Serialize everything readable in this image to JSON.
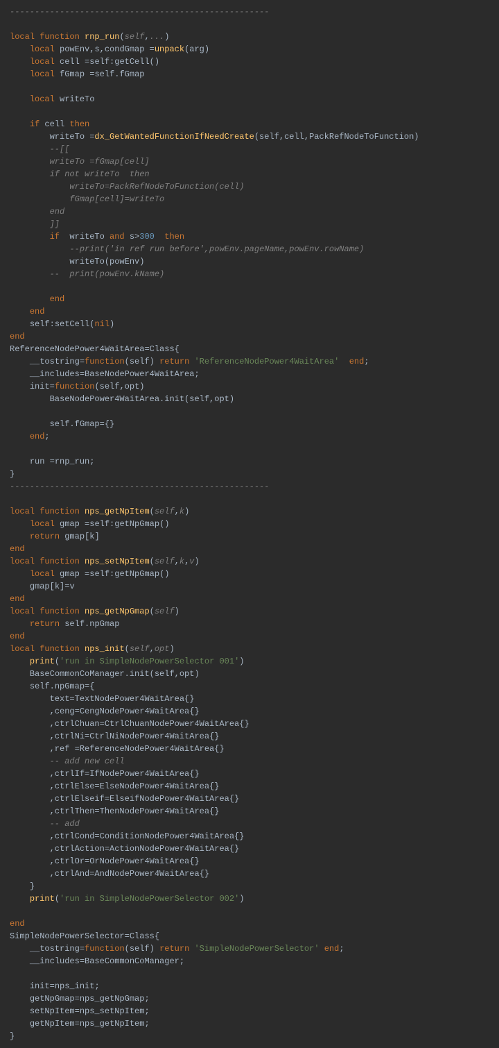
{
  "lines": [
    {
      "indent": 0,
      "parts": [
        {
          "c": "cmt",
          "t": "----------------------------------------------------"
        }
      ]
    },
    {
      "indent": 0,
      "parts": []
    },
    {
      "indent": 0,
      "parts": [
        {
          "c": "kw",
          "t": "local function "
        },
        {
          "c": "fn",
          "t": "rnp_run"
        },
        {
          "c": "pun",
          "t": "("
        },
        {
          "c": "par",
          "t": "self"
        },
        {
          "c": "pun",
          "t": ","
        },
        {
          "c": "par",
          "t": "..."
        },
        {
          "c": "pun",
          "t": ")"
        }
      ]
    },
    {
      "indent": 1,
      "parts": [
        {
          "c": "kw",
          "t": "local "
        },
        {
          "c": "nm",
          "t": "powEnv,s,condGmap "
        },
        {
          "c": "op",
          "t": "="
        },
        {
          "c": "fn",
          "t": "unpack"
        },
        {
          "c": "pun",
          "t": "(arg)"
        }
      ]
    },
    {
      "indent": 1,
      "parts": [
        {
          "c": "kw",
          "t": "local "
        },
        {
          "c": "nm",
          "t": "cell "
        },
        {
          "c": "op",
          "t": "="
        },
        {
          "c": "nm",
          "t": "self:getCell()"
        }
      ]
    },
    {
      "indent": 1,
      "parts": [
        {
          "c": "kw",
          "t": "local "
        },
        {
          "c": "nm",
          "t": "fGmap "
        },
        {
          "c": "op",
          "t": "="
        },
        {
          "c": "nm",
          "t": "self.fGmap"
        }
      ]
    },
    {
      "indent": 0,
      "parts": []
    },
    {
      "indent": 1,
      "parts": [
        {
          "c": "kw",
          "t": "local "
        },
        {
          "c": "nm",
          "t": "writeTo"
        }
      ]
    },
    {
      "indent": 0,
      "parts": []
    },
    {
      "indent": 1,
      "parts": [
        {
          "c": "kw",
          "t": "if "
        },
        {
          "c": "nm",
          "t": "cell "
        },
        {
          "c": "kw",
          "t": "then"
        }
      ]
    },
    {
      "indent": 2,
      "parts": [
        {
          "c": "nm",
          "t": "writeTo "
        },
        {
          "c": "op",
          "t": "="
        },
        {
          "c": "fn",
          "t": "dx_GetWantedFunctionIfNeedCreate"
        },
        {
          "c": "pun",
          "t": "(self,cell,PackRefNodeToFunction)"
        }
      ]
    },
    {
      "indent": 2,
      "parts": [
        {
          "c": "cmt",
          "t": "--[["
        }
      ]
    },
    {
      "indent": 2,
      "parts": [
        {
          "c": "cmt",
          "t": "writeTo =fGmap[cell]"
        }
      ]
    },
    {
      "indent": 2,
      "parts": [
        {
          "c": "cmt",
          "t": "if not writeTo  then"
        }
      ]
    },
    {
      "indent": 3,
      "parts": [
        {
          "c": "cmt",
          "t": "writeTo=PackRefNodeToFunction(cell)"
        }
      ]
    },
    {
      "indent": 3,
      "parts": [
        {
          "c": "cmt",
          "t": "fGmap[cell]=writeTo"
        }
      ]
    },
    {
      "indent": 2,
      "parts": [
        {
          "c": "cmt",
          "t": "end"
        }
      ]
    },
    {
      "indent": 2,
      "parts": [
        {
          "c": "cmt",
          "t": "]]"
        }
      ]
    },
    {
      "indent": 2,
      "parts": [
        {
          "c": "kw",
          "t": "if  "
        },
        {
          "c": "nm",
          "t": "writeTo "
        },
        {
          "c": "kw",
          "t": "and "
        },
        {
          "c": "nm",
          "t": "s"
        },
        {
          "c": "op",
          "t": ">"
        },
        {
          "c": "num",
          "t": "300"
        },
        {
          "c": "kw",
          "t": "  then"
        }
      ]
    },
    {
      "indent": 3,
      "parts": [
        {
          "c": "cmt",
          "t": "--print('in ref run before',powEnv.pageName,powEnv.rowName)"
        }
      ]
    },
    {
      "indent": 3,
      "parts": [
        {
          "c": "nm",
          "t": "writeTo(powEnv)"
        }
      ]
    },
    {
      "indent": 2,
      "parts": [
        {
          "c": "cmt",
          "t": "--  print(powEnv.kName)"
        }
      ]
    },
    {
      "indent": 0,
      "parts": []
    },
    {
      "indent": 2,
      "parts": [
        {
          "c": "kw",
          "t": "end"
        }
      ]
    },
    {
      "indent": 1,
      "parts": [
        {
          "c": "kw",
          "t": "end"
        }
      ]
    },
    {
      "indent": 1,
      "parts": [
        {
          "c": "nm",
          "t": "self:setCell("
        },
        {
          "c": "kw",
          "t": "nil"
        },
        {
          "c": "nm",
          "t": ")"
        }
      ]
    },
    {
      "indent": 0,
      "parts": [
        {
          "c": "kw",
          "t": "end"
        }
      ]
    },
    {
      "indent": 0,
      "parts": [
        {
          "c": "nm",
          "t": "ReferenceNodePower4WaitArea"
        },
        {
          "c": "op",
          "t": "="
        },
        {
          "c": "nm",
          "t": "Class{"
        }
      ]
    },
    {
      "indent": 1,
      "parts": [
        {
          "c": "nm",
          "t": "__tostring"
        },
        {
          "c": "op",
          "t": "="
        },
        {
          "c": "kw",
          "t": "function"
        },
        {
          "c": "pun",
          "t": "(self) "
        },
        {
          "c": "kw",
          "t": "return "
        },
        {
          "c": "str",
          "t": "'ReferenceNodePower4WaitArea'"
        },
        {
          "c": "kw",
          "t": "  end"
        },
        {
          "c": "pun",
          "t": ";"
        }
      ]
    },
    {
      "indent": 1,
      "parts": [
        {
          "c": "nm",
          "t": "__includes"
        },
        {
          "c": "op",
          "t": "="
        },
        {
          "c": "nm",
          "t": "BaseNodePower4WaitArea;"
        }
      ]
    },
    {
      "indent": 1,
      "parts": [
        {
          "c": "nm",
          "t": "init"
        },
        {
          "c": "op",
          "t": "="
        },
        {
          "c": "kw",
          "t": "function"
        },
        {
          "c": "pun",
          "t": "(self,opt)"
        }
      ]
    },
    {
      "indent": 2,
      "parts": [
        {
          "c": "nm",
          "t": "BaseNodePower4WaitArea.init(self,opt)"
        }
      ]
    },
    {
      "indent": 0,
      "parts": []
    },
    {
      "indent": 2,
      "parts": [
        {
          "c": "nm",
          "t": "self.fGmap"
        },
        {
          "c": "op",
          "t": "="
        },
        {
          "c": "nm",
          "t": "{}"
        }
      ]
    },
    {
      "indent": 1,
      "parts": [
        {
          "c": "kw",
          "t": "end"
        },
        {
          "c": "pun",
          "t": ";"
        }
      ]
    },
    {
      "indent": 0,
      "parts": []
    },
    {
      "indent": 1,
      "parts": [
        {
          "c": "nm",
          "t": "run "
        },
        {
          "c": "op",
          "t": "="
        },
        {
          "c": "nm",
          "t": "rnp_run;"
        }
      ]
    },
    {
      "indent": 0,
      "parts": [
        {
          "c": "nm",
          "t": "}"
        }
      ]
    },
    {
      "indent": 0,
      "parts": [
        {
          "c": "cmt",
          "t": "----------------------------------------------------"
        }
      ]
    },
    {
      "indent": 0,
      "parts": []
    },
    {
      "indent": 0,
      "parts": [
        {
          "c": "kw",
          "t": "local function "
        },
        {
          "c": "fn",
          "t": "nps_getNpItem"
        },
        {
          "c": "pun",
          "t": "("
        },
        {
          "c": "par",
          "t": "self"
        },
        {
          "c": "pun",
          "t": ","
        },
        {
          "c": "par",
          "t": "k"
        },
        {
          "c": "pun",
          "t": ")"
        }
      ]
    },
    {
      "indent": 1,
      "parts": [
        {
          "c": "kw",
          "t": "local "
        },
        {
          "c": "nm",
          "t": "gmap "
        },
        {
          "c": "op",
          "t": "="
        },
        {
          "c": "nm",
          "t": "self:getNpGmap()"
        }
      ]
    },
    {
      "indent": 1,
      "parts": [
        {
          "c": "kw",
          "t": "return "
        },
        {
          "c": "nm",
          "t": "gmap[k]"
        }
      ]
    },
    {
      "indent": 0,
      "parts": [
        {
          "c": "kw",
          "t": "end"
        }
      ]
    },
    {
      "indent": 0,
      "parts": [
        {
          "c": "kw",
          "t": "local function "
        },
        {
          "c": "fn",
          "t": "nps_setNpItem"
        },
        {
          "c": "pun",
          "t": "("
        },
        {
          "c": "par",
          "t": "self"
        },
        {
          "c": "pun",
          "t": ","
        },
        {
          "c": "par",
          "t": "k"
        },
        {
          "c": "pun",
          "t": ","
        },
        {
          "c": "par",
          "t": "v"
        },
        {
          "c": "pun",
          "t": ")"
        }
      ]
    },
    {
      "indent": 1,
      "parts": [
        {
          "c": "kw",
          "t": "local "
        },
        {
          "c": "nm",
          "t": "gmap "
        },
        {
          "c": "op",
          "t": "="
        },
        {
          "c": "nm",
          "t": "self:getNpGmap()"
        }
      ]
    },
    {
      "indent": 1,
      "parts": [
        {
          "c": "nm",
          "t": "gmap[k]"
        },
        {
          "c": "op",
          "t": "="
        },
        {
          "c": "nm",
          "t": "v"
        }
      ]
    },
    {
      "indent": 0,
      "parts": [
        {
          "c": "kw",
          "t": "end"
        }
      ]
    },
    {
      "indent": 0,
      "parts": [
        {
          "c": "kw",
          "t": "local function "
        },
        {
          "c": "fn",
          "t": "nps_getNpGmap"
        },
        {
          "c": "pun",
          "t": "("
        },
        {
          "c": "par",
          "t": "self"
        },
        {
          "c": "pun",
          "t": ")"
        }
      ]
    },
    {
      "indent": 1,
      "parts": [
        {
          "c": "kw",
          "t": "return "
        },
        {
          "c": "nm",
          "t": "self.npGmap"
        }
      ]
    },
    {
      "indent": 0,
      "parts": [
        {
          "c": "kw",
          "t": "end"
        }
      ]
    },
    {
      "indent": 0,
      "parts": [
        {
          "c": "kw",
          "t": "local function "
        },
        {
          "c": "fn",
          "t": "nps_init"
        },
        {
          "c": "pun",
          "t": "("
        },
        {
          "c": "par",
          "t": "self"
        },
        {
          "c": "pun",
          "t": ","
        },
        {
          "c": "par",
          "t": "opt"
        },
        {
          "c": "pun",
          "t": ")"
        }
      ]
    },
    {
      "indent": 1,
      "parts": [
        {
          "c": "fn",
          "t": "print"
        },
        {
          "c": "pun",
          "t": "("
        },
        {
          "c": "str",
          "t": "'run in SimpleNodePowerSelector 001'"
        },
        {
          "c": "pun",
          "t": ")"
        }
      ]
    },
    {
      "indent": 1,
      "parts": [
        {
          "c": "nm",
          "t": "BaseCommonCoManager.init(self,opt)"
        }
      ]
    },
    {
      "indent": 1,
      "parts": [
        {
          "c": "nm",
          "t": "self.npGmap"
        },
        {
          "c": "op",
          "t": "="
        },
        {
          "c": "nm",
          "t": "{"
        }
      ]
    },
    {
      "indent": 2,
      "parts": [
        {
          "c": "nm",
          "t": "text"
        },
        {
          "c": "op",
          "t": "="
        },
        {
          "c": "nm",
          "t": "TextNodePower4WaitArea{}"
        }
      ]
    },
    {
      "indent": 2,
      "parts": [
        {
          "c": "nm",
          "t": ",ceng"
        },
        {
          "c": "op",
          "t": "="
        },
        {
          "c": "nm",
          "t": "CengNodePower4WaitArea{}"
        }
      ]
    },
    {
      "indent": 2,
      "parts": [
        {
          "c": "nm",
          "t": ",ctrlChuan"
        },
        {
          "c": "op",
          "t": "="
        },
        {
          "c": "nm",
          "t": "CtrlChuanNodePower4WaitArea{}"
        }
      ]
    },
    {
      "indent": 2,
      "parts": [
        {
          "c": "nm",
          "t": ",ctrlNi"
        },
        {
          "c": "op",
          "t": "="
        },
        {
          "c": "nm",
          "t": "CtrlNiNodePower4WaitArea{}"
        }
      ]
    },
    {
      "indent": 2,
      "parts": [
        {
          "c": "nm",
          "t": ",ref "
        },
        {
          "c": "op",
          "t": "="
        },
        {
          "c": "nm",
          "t": "ReferenceNodePower4WaitArea{}"
        }
      ]
    },
    {
      "indent": 2,
      "parts": [
        {
          "c": "cmt",
          "t": "-- add new cell"
        }
      ]
    },
    {
      "indent": 2,
      "parts": [
        {
          "c": "nm",
          "t": ",ctrlIf"
        },
        {
          "c": "op",
          "t": "="
        },
        {
          "c": "nm",
          "t": "IfNodePower4WaitArea{}"
        }
      ]
    },
    {
      "indent": 2,
      "parts": [
        {
          "c": "nm",
          "t": ",ctrlElse"
        },
        {
          "c": "op",
          "t": "="
        },
        {
          "c": "nm",
          "t": "ElseNodePower4WaitArea{}"
        }
      ]
    },
    {
      "indent": 2,
      "parts": [
        {
          "c": "nm",
          "t": ",ctrlElseif"
        },
        {
          "c": "op",
          "t": "="
        },
        {
          "c": "nm",
          "t": "ElseifNodePower4WaitArea{}"
        }
      ]
    },
    {
      "indent": 2,
      "parts": [
        {
          "c": "nm",
          "t": ",ctrlThen"
        },
        {
          "c": "op",
          "t": "="
        },
        {
          "c": "nm",
          "t": "ThenNodePower4WaitArea{}"
        }
      ]
    },
    {
      "indent": 2,
      "parts": [
        {
          "c": "cmt",
          "t": "-- add"
        }
      ]
    },
    {
      "indent": 2,
      "parts": [
        {
          "c": "nm",
          "t": ",ctrlCond"
        },
        {
          "c": "op",
          "t": "="
        },
        {
          "c": "nm",
          "t": "ConditionNodePower4WaitArea{}"
        }
      ]
    },
    {
      "indent": 2,
      "parts": [
        {
          "c": "nm",
          "t": ",ctrlAction"
        },
        {
          "c": "op",
          "t": "="
        },
        {
          "c": "nm",
          "t": "ActionNodePower4WaitArea{}"
        }
      ]
    },
    {
      "indent": 2,
      "parts": [
        {
          "c": "nm",
          "t": ",ctrlOr"
        },
        {
          "c": "op",
          "t": "="
        },
        {
          "c": "nm",
          "t": "OrNodePower4WaitArea{}"
        }
      ]
    },
    {
      "indent": 2,
      "parts": [
        {
          "c": "nm",
          "t": ",ctrlAnd"
        },
        {
          "c": "op",
          "t": "="
        },
        {
          "c": "nm",
          "t": "AndNodePower4WaitArea{}"
        }
      ]
    },
    {
      "indent": 1,
      "parts": [
        {
          "c": "nm",
          "t": "}"
        }
      ]
    },
    {
      "indent": 1,
      "parts": [
        {
          "c": "fn",
          "t": "print"
        },
        {
          "c": "pun",
          "t": "("
        },
        {
          "c": "str",
          "t": "'run in SimpleNodePowerSelector 002'"
        },
        {
          "c": "pun",
          "t": ")"
        }
      ]
    },
    {
      "indent": 0,
      "parts": []
    },
    {
      "indent": 0,
      "parts": [
        {
          "c": "kw",
          "t": "end"
        }
      ]
    },
    {
      "indent": 0,
      "parts": [
        {
          "c": "nm",
          "t": "SimpleNodePowerSelector"
        },
        {
          "c": "op",
          "t": "="
        },
        {
          "c": "nm",
          "t": "Class{"
        }
      ]
    },
    {
      "indent": 1,
      "parts": [
        {
          "c": "nm",
          "t": "__tostring"
        },
        {
          "c": "op",
          "t": "="
        },
        {
          "c": "kw",
          "t": "function"
        },
        {
          "c": "pun",
          "t": "(self) "
        },
        {
          "c": "kw",
          "t": "return "
        },
        {
          "c": "str",
          "t": "'SimpleNodePowerSelector'"
        },
        {
          "c": "kw",
          "t": " end"
        },
        {
          "c": "pun",
          "t": ";"
        }
      ]
    },
    {
      "indent": 1,
      "parts": [
        {
          "c": "nm",
          "t": "__includes"
        },
        {
          "c": "op",
          "t": "="
        },
        {
          "c": "nm",
          "t": "BaseCommonCoManager;"
        }
      ]
    },
    {
      "indent": 0,
      "parts": []
    },
    {
      "indent": 1,
      "parts": [
        {
          "c": "nm",
          "t": "init"
        },
        {
          "c": "op",
          "t": "="
        },
        {
          "c": "nm",
          "t": "nps_init;"
        }
      ]
    },
    {
      "indent": 1,
      "parts": [
        {
          "c": "nm",
          "t": "getNpGmap"
        },
        {
          "c": "op",
          "t": "="
        },
        {
          "c": "nm",
          "t": "nps_getNpGmap;"
        }
      ]
    },
    {
      "indent": 1,
      "parts": [
        {
          "c": "nm",
          "t": "setNpItem"
        },
        {
          "c": "op",
          "t": "="
        },
        {
          "c": "nm",
          "t": "nps_setNpItem;"
        }
      ]
    },
    {
      "indent": 1,
      "parts": [
        {
          "c": "nm",
          "t": "getNpItem"
        },
        {
          "c": "op",
          "t": "="
        },
        {
          "c": "nm",
          "t": "nps_getNpItem;"
        }
      ]
    },
    {
      "indent": 0,
      "parts": [
        {
          "c": "nm",
          "t": "}"
        }
      ]
    }
  ],
  "indentUnit": "    "
}
